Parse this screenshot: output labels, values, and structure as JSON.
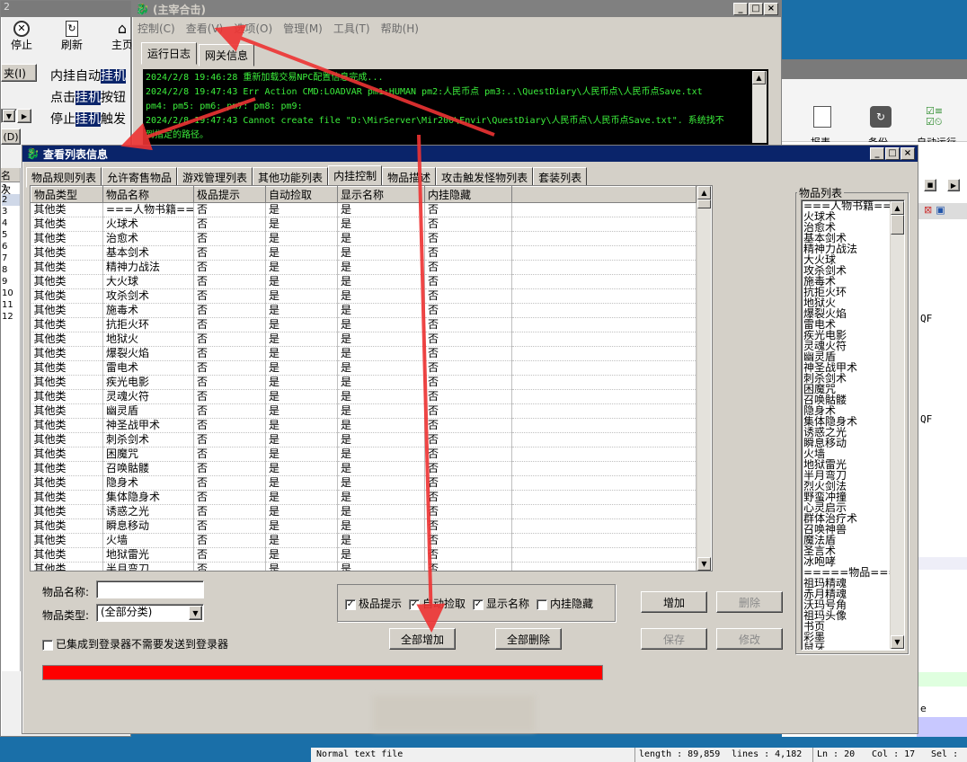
{
  "left_app": {
    "title": "2",
    "toolbar": [
      {
        "label": "停止",
        "icon": "stop-icon"
      },
      {
        "label": "刷新",
        "icon": "refresh-icon"
      },
      {
        "label": "主页",
        "icon": "home-icon"
      }
    ],
    "frag1": "夹(I)",
    "frag2": "名次",
    "frag3": "(D)",
    "row_numbers": [
      "1",
      "2",
      "3",
      "4",
      "5",
      "6",
      "7",
      "8",
      "9",
      "10",
      "11",
      "12"
    ],
    "text_lines": [
      {
        "before": "内挂自动",
        "hl": "挂机",
        "after": ""
      },
      {
        "before": "点击",
        "hl": "挂机",
        "after": "按钮"
      },
      {
        "before": "停止",
        "hl": "挂机",
        "after": "触发"
      }
    ]
  },
  "main_window": {
    "title": "(主宰合击)",
    "menu": [
      "控制(C)",
      "查看(V)",
      "选项(O)",
      "管理(M)",
      "工具(T)",
      "帮助(H)"
    ],
    "tabs": [
      "运行日志",
      "网关信息"
    ],
    "log_lines": [
      "2024/2/8 19:46:28 重新加载交易NPC配置信息完成...",
      "2024/2/8 19:47:43 Err Action CMD:LOADVAR pm1:HUMAN pm2:人民币点 pm3:..\\QuestDiary\\人民币点\\人民币点Save.txt",
      "pm4: pm5: pm6: pm7: pm8: pm9:",
      "2024/2/8 19:47:43 Cannot create file \"D:\\MirServer\\Mir200\\Envir\\QuestDiary\\人民币点\\人民币点Save.txt\". 系统找不",
      "到指定的路径。"
    ]
  },
  "right_app": {
    "toolbar": [
      "报表",
      "备份",
      "自动运行"
    ],
    "snippets": [
      "QF",
      "QF",
      "e"
    ]
  },
  "dialog": {
    "title": "查看列表信息",
    "tabs": [
      "物品规则列表",
      "允许寄售物品",
      "游戏管理列表",
      "其他功能列表",
      "内挂控制",
      "物品描述",
      "攻击触发怪物列表",
      "套装列表"
    ],
    "selected_tab": "内挂控制",
    "columns": [
      "物品类型",
      "物品名称",
      "极品提示",
      "自动捡取",
      "显示名称",
      "内挂隐藏"
    ],
    "rows": [
      [
        "其他类",
        "===人物书籍===",
        "否",
        "是",
        "是",
        "否"
      ],
      [
        "其他类",
        "火球术",
        "否",
        "是",
        "是",
        "否"
      ],
      [
        "其他类",
        "治愈术",
        "否",
        "是",
        "是",
        "否"
      ],
      [
        "其他类",
        "基本剑术",
        "否",
        "是",
        "是",
        "否"
      ],
      [
        "其他类",
        "精神力战法",
        "否",
        "是",
        "是",
        "否"
      ],
      [
        "其他类",
        "大火球",
        "否",
        "是",
        "是",
        "否"
      ],
      [
        "其他类",
        "攻杀剑术",
        "否",
        "是",
        "是",
        "否"
      ],
      [
        "其他类",
        "施毒术",
        "否",
        "是",
        "是",
        "否"
      ],
      [
        "其他类",
        "抗拒火环",
        "否",
        "是",
        "是",
        "否"
      ],
      [
        "其他类",
        "地狱火",
        "否",
        "是",
        "是",
        "否"
      ],
      [
        "其他类",
        "爆裂火焰",
        "否",
        "是",
        "是",
        "否"
      ],
      [
        "其他类",
        "雷电术",
        "否",
        "是",
        "是",
        "否"
      ],
      [
        "其他类",
        "疾光电影",
        "否",
        "是",
        "是",
        "否"
      ],
      [
        "其他类",
        "灵魂火符",
        "否",
        "是",
        "是",
        "否"
      ],
      [
        "其他类",
        "幽灵盾",
        "否",
        "是",
        "是",
        "否"
      ],
      [
        "其他类",
        "神圣战甲术",
        "否",
        "是",
        "是",
        "否"
      ],
      [
        "其他类",
        "刺杀剑术",
        "否",
        "是",
        "是",
        "否"
      ],
      [
        "其他类",
        "困魔咒",
        "否",
        "是",
        "是",
        "否"
      ],
      [
        "其他类",
        "召唤骷髅",
        "否",
        "是",
        "是",
        "否"
      ],
      [
        "其他类",
        "隐身术",
        "否",
        "是",
        "是",
        "否"
      ],
      [
        "其他类",
        "集体隐身术",
        "否",
        "是",
        "是",
        "否"
      ],
      [
        "其他类",
        "诱惑之光",
        "否",
        "是",
        "是",
        "否"
      ],
      [
        "其他类",
        "瞬息移动",
        "否",
        "是",
        "是",
        "否"
      ],
      [
        "其他类",
        "火墙",
        "否",
        "是",
        "是",
        "否"
      ],
      [
        "其他类",
        "地狱雷光",
        "否",
        "是",
        "是",
        "否"
      ],
      [
        "其他类",
        "半月弯刀",
        "否",
        "是",
        "是",
        "否"
      ]
    ],
    "item_name_label": "物品名称:",
    "item_name_value": "",
    "item_type_label": "物品类型:",
    "item_type_value": "(全部分类)",
    "checkboxes": [
      {
        "label": "极品提示",
        "checked": true
      },
      {
        "label": "自动捡取",
        "checked": true
      },
      {
        "label": "显示名称",
        "checked": true
      },
      {
        "label": "内挂隐藏",
        "checked": false
      }
    ],
    "integrated_label": "已集成到登录器不需要发送到登录器",
    "buttons": {
      "add": "增加",
      "delete": "删除",
      "save": "保存",
      "modify": "修改",
      "add_all": "全部增加",
      "delete_all": "全部删除"
    },
    "item_list_title": "物品列表",
    "item_list": [
      "===人物书籍===",
      "火球术",
      "治愈术",
      "基本剑术",
      "精神力战法",
      "大火球",
      "攻杀剑术",
      "施毒术",
      "抗拒火环",
      "地狱火",
      "爆裂火焰",
      "雷电术",
      "疾光电影",
      "灵魂火符",
      "幽灵盾",
      "神圣战甲术",
      "刺杀剑术",
      "困魔咒",
      "召唤骷髅",
      "隐身术",
      "集体隐身术",
      "诱惑之光",
      "瞬息移动",
      "火墙",
      "地狱雷光",
      "半月弯刀",
      "烈火剑法",
      "野蛮冲撞",
      "心灵启示",
      "群体治疗术",
      "召唤神兽",
      "魔法盾",
      "圣言术",
      "冰咆哮",
      "=====物品=====",
      "祖玛精魂",
      "赤月精魂",
      "沃玛号角",
      "祖玛头像",
      "书页",
      "彩墨",
      "鼠牙"
    ],
    "progress_color": "#ff0000",
    "progress": 1.0
  },
  "statusbar": {
    "file_type": "Normal text file",
    "length": "length : 89,859",
    "lines": "lines : 4,182",
    "ln": "Ln : 20",
    "col": "Col : 17",
    "sel": "Sel :"
  },
  "annotation_color": "#ee3333"
}
